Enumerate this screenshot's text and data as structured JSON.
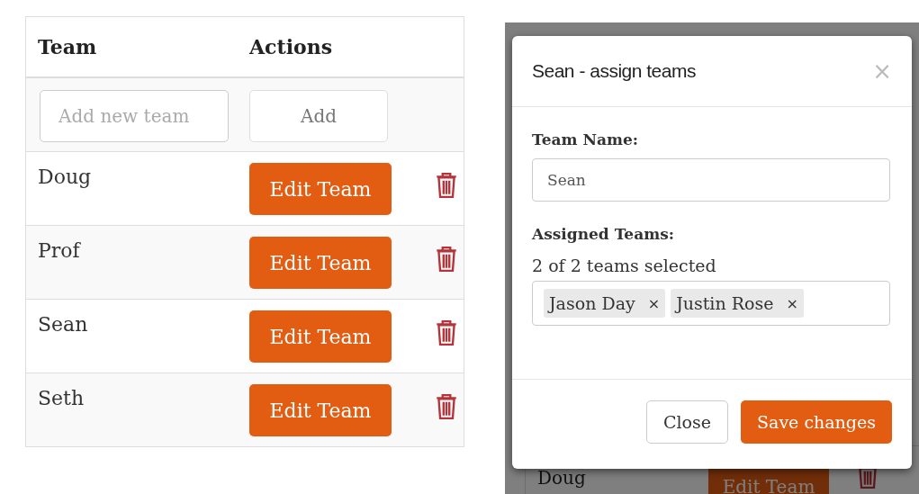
{
  "table": {
    "columns": [
      "Team",
      "Actions"
    ],
    "new_team": {
      "placeholder": "Add new team",
      "button": "Add"
    },
    "rows": [
      {
        "name": "Doug",
        "button": "Edit Team"
      },
      {
        "name": "Prof",
        "button": "Edit Team"
      },
      {
        "name": "Sean",
        "button": "Edit Team"
      },
      {
        "name": "Seth",
        "button": "Edit Team"
      }
    ]
  },
  "background_page": {
    "row": {
      "name": "Doug",
      "button": "Edit Team"
    }
  },
  "modal": {
    "title": "Sean - assign teams",
    "close_icon": "×",
    "team_name_label": "Team Name:",
    "team_name_value": "Sean",
    "assigned_label": "Assigned Teams:",
    "selection_count": "2 of 2 teams selected",
    "tags": [
      {
        "label": "Jason Day",
        "remove": "×"
      },
      {
        "label": "Justin Rose",
        "remove": "×"
      }
    ],
    "buttons": [
      {
        "label": "Close",
        "kind": "secondary"
      },
      {
        "label": "Save changes",
        "kind": "primary"
      }
    ]
  }
}
